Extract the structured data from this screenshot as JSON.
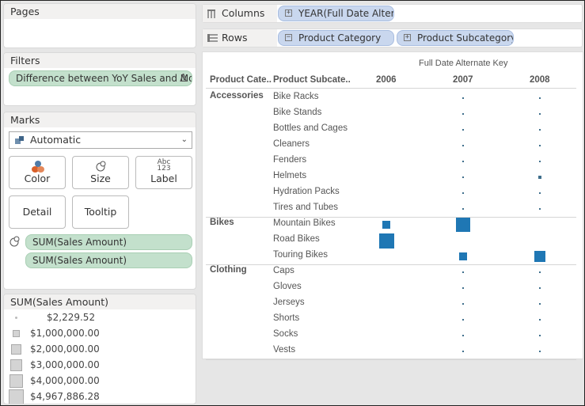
{
  "pages": {
    "title": "Pages"
  },
  "filters": {
    "title": "Filters",
    "items": [
      {
        "label": "Difference between YoY Sales and Mo..",
        "icon": "delta-icon",
        "glyph": "Δ"
      }
    ]
  },
  "marks": {
    "title": "Marks",
    "mark_type": "Automatic",
    "buttons": [
      {
        "label": "Color",
        "icon": "color-icon"
      },
      {
        "label": "Size",
        "icon": "size-icon"
      },
      {
        "label": "Label",
        "icon": "label-icon",
        "glyph_top": "Abc",
        "glyph_bottom": "123"
      },
      {
        "label": "Detail"
      },
      {
        "label": "Tooltip"
      }
    ],
    "fields": [
      {
        "label": "SUM(Sales Amount)",
        "icon": "size-icon"
      },
      {
        "label": "SUM(Sales Amount)"
      }
    ]
  },
  "size_legend": {
    "title": "SUM(Sales Amount)",
    "items": [
      {
        "label": "$2,229.52",
        "value": 2229.52
      },
      {
        "label": "$1,000,000.00",
        "value": 1000000
      },
      {
        "label": "$2,000,000.00",
        "value": 2000000
      },
      {
        "label": "$3,000,000.00",
        "value": 3000000
      },
      {
        "label": "$4,000,000.00",
        "value": 4000000
      },
      {
        "label": "$4,967,886.28",
        "value": 4967886.28
      }
    ]
  },
  "shelves": {
    "columns": {
      "label": "Columns",
      "pills": [
        {
          "label": "YEAR(Full Date Altern..",
          "expander": "+"
        }
      ]
    },
    "rows": {
      "label": "Rows",
      "pills": [
        {
          "label": "Product Category",
          "expander": "−"
        },
        {
          "label": "Product Subcategory",
          "expander": "+"
        }
      ]
    }
  },
  "view": {
    "column_title": "Full Date Alternate Key",
    "row_headers": [
      "Product Cate..",
      "Product Subcate.."
    ],
    "years": [
      "2006",
      "2007",
      "2008"
    ],
    "mark_color": "#1f77b4",
    "groups": [
      {
        "category": "Accessories",
        "rows": [
          {
            "sub": "Bike Racks",
            "values": [
              null,
              40000,
              60000
            ]
          },
          {
            "sub": "Bike Stands",
            "values": [
              null,
              25000,
              35000
            ]
          },
          {
            "sub": "Bottles and Cages",
            "values": [
              null,
              20000,
              35000
            ]
          },
          {
            "sub": "Cleaners",
            "values": [
              null,
              8000,
              12000
            ]
          },
          {
            "sub": "Fenders",
            "values": [
              null,
              15000,
              28000
            ]
          },
          {
            "sub": "Helmets",
            "values": [
              null,
              90000,
              140000
            ]
          },
          {
            "sub": "Hydration Packs",
            "values": [
              null,
              20000,
              35000
            ]
          },
          {
            "sub": "Tires and Tubes",
            "values": [
              null,
              90000,
              120000
            ]
          }
        ]
      },
      {
        "category": "Bikes",
        "rows": [
          {
            "sub": "Mountain Bikes",
            "values": [
              1500000,
              4300000,
              null
            ]
          },
          {
            "sub": "Road Bikes",
            "values": [
              4967886.28,
              null,
              null
            ]
          },
          {
            "sub": "Touring Bikes",
            "values": [
              null,
              1400000,
              2400000
            ]
          }
        ]
      },
      {
        "category": "Clothing",
        "rows": [
          {
            "sub": "Caps",
            "values": [
              null,
              8000,
              12000
            ]
          },
          {
            "sub": "Gloves",
            "values": [
              null,
              15000,
              25000
            ]
          },
          {
            "sub": "Jerseys",
            "values": [
              null,
              60000,
              80000
            ]
          },
          {
            "sub": "Shorts",
            "values": [
              null,
              30000,
              45000
            ]
          },
          {
            "sub": "Socks",
            "values": [
              null,
              2229.52,
              4000
            ]
          },
          {
            "sub": "Vests",
            "values": [
              null,
              10000,
              20000
            ]
          }
        ]
      }
    ]
  }
}
